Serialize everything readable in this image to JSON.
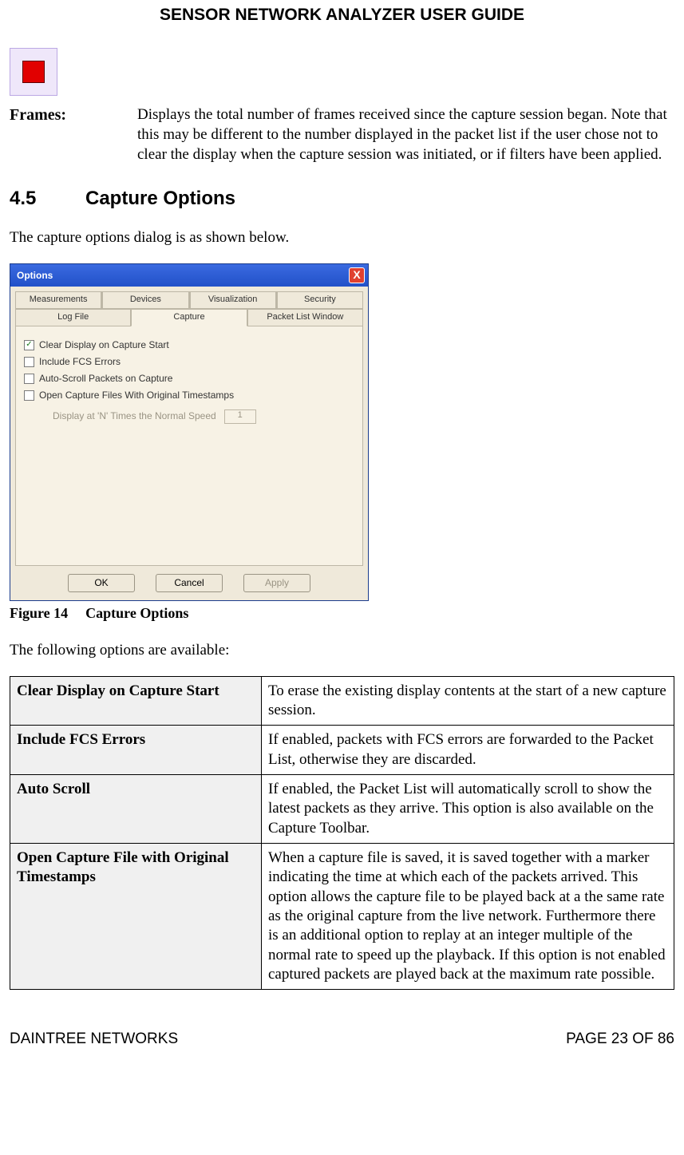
{
  "header": {
    "title": "SENSOR NETWORK ANALYZER USER GUIDE"
  },
  "stop_icon": {
    "name": "stop-icon"
  },
  "frames": {
    "label": "Frames:",
    "text": "Displays the total number of frames received since the capture session began. Note that this may be different to the number displayed in the packet list if the user chose not to clear the display when the capture session was initiated, or if filters have been applied."
  },
  "section": {
    "number": "4.5",
    "title": "Capture Options",
    "intro": "The capture options dialog is as shown below."
  },
  "dialog": {
    "title": "Options",
    "tabs_row1": [
      "Measurements",
      "Devices",
      "Visualization",
      "Security"
    ],
    "tabs_row2": [
      "Log File",
      "Capture",
      "Packet List Window"
    ],
    "active_tab": "Capture",
    "checkboxes": [
      {
        "label": "Clear Display on Capture Start",
        "checked": true
      },
      {
        "label": "Include FCS Errors",
        "checked": false
      },
      {
        "label": "Auto-Scroll Packets on Capture",
        "checked": false
      },
      {
        "label": "Open Capture Files With Original Timestamps",
        "checked": false
      }
    ],
    "sub_option": {
      "label": "Display at 'N' Times the Normal Speed",
      "value": "1"
    },
    "buttons": {
      "ok": "OK",
      "cancel": "Cancel",
      "apply": "Apply"
    }
  },
  "figure": {
    "number": "Figure 14",
    "title": "Capture Options"
  },
  "options_intro": "The following options are available:",
  "options_table": [
    {
      "name": "Clear Display on Capture Start",
      "desc": "To erase the existing display contents at the start of a new capture session."
    },
    {
      "name": "Include FCS Errors",
      "desc": "If enabled, packets with FCS errors are forwarded to the Packet List, otherwise they are discarded."
    },
    {
      "name": "Auto Scroll",
      "desc": "If enabled, the Packet List will automatically scroll to show the latest packets as they arrive. This option is also available on the Capture Toolbar."
    },
    {
      "name": "Open Capture File with Original Timestamps",
      "desc": "When a capture file is saved, it is saved together with a marker indicating the time at which each of the packets arrived. This option allows the capture file to be played back at a the same rate as the original capture from the live network. Furthermore there is an additional option to replay at an integer multiple of the normal rate to speed up the playback. If this option is not enabled captured packets are played back at the maximum rate possible."
    }
  ],
  "footer": {
    "left": "DAINTREE NETWORKS",
    "right": "PAGE 23 OF 86"
  }
}
